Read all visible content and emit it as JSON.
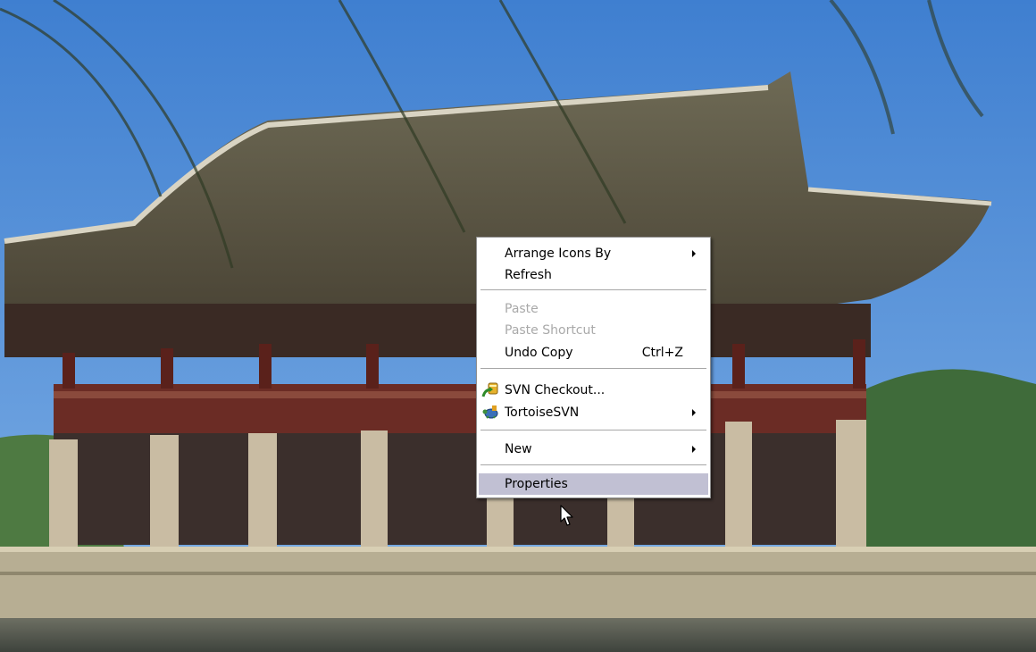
{
  "context_menu": {
    "arrange_icons": {
      "label": "Arrange Icons By",
      "icon": "submenu-arrow"
    },
    "refresh": {
      "label": "Refresh"
    },
    "paste": {
      "label": "Paste",
      "disabled": true
    },
    "paste_shortcut": {
      "label": "Paste Shortcut",
      "disabled": true
    },
    "undo_copy": {
      "label": "Undo Copy",
      "shortcut": "Ctrl+Z"
    },
    "svn_checkout": {
      "label": "SVN Checkout...",
      "icon": "svn-checkout-icon"
    },
    "tortoise_svn": {
      "label": "TortoiseSVN",
      "icon": "tortoisesvn-icon"
    },
    "new": {
      "label": "New"
    },
    "properties": {
      "label": "Properties",
      "highlighted": true
    }
  },
  "colors": {
    "menu_background": "#ffffff",
    "highlight": "#c1c0d3",
    "disabled_text": "#a9a9a9",
    "sky": "#4a86d0"
  }
}
